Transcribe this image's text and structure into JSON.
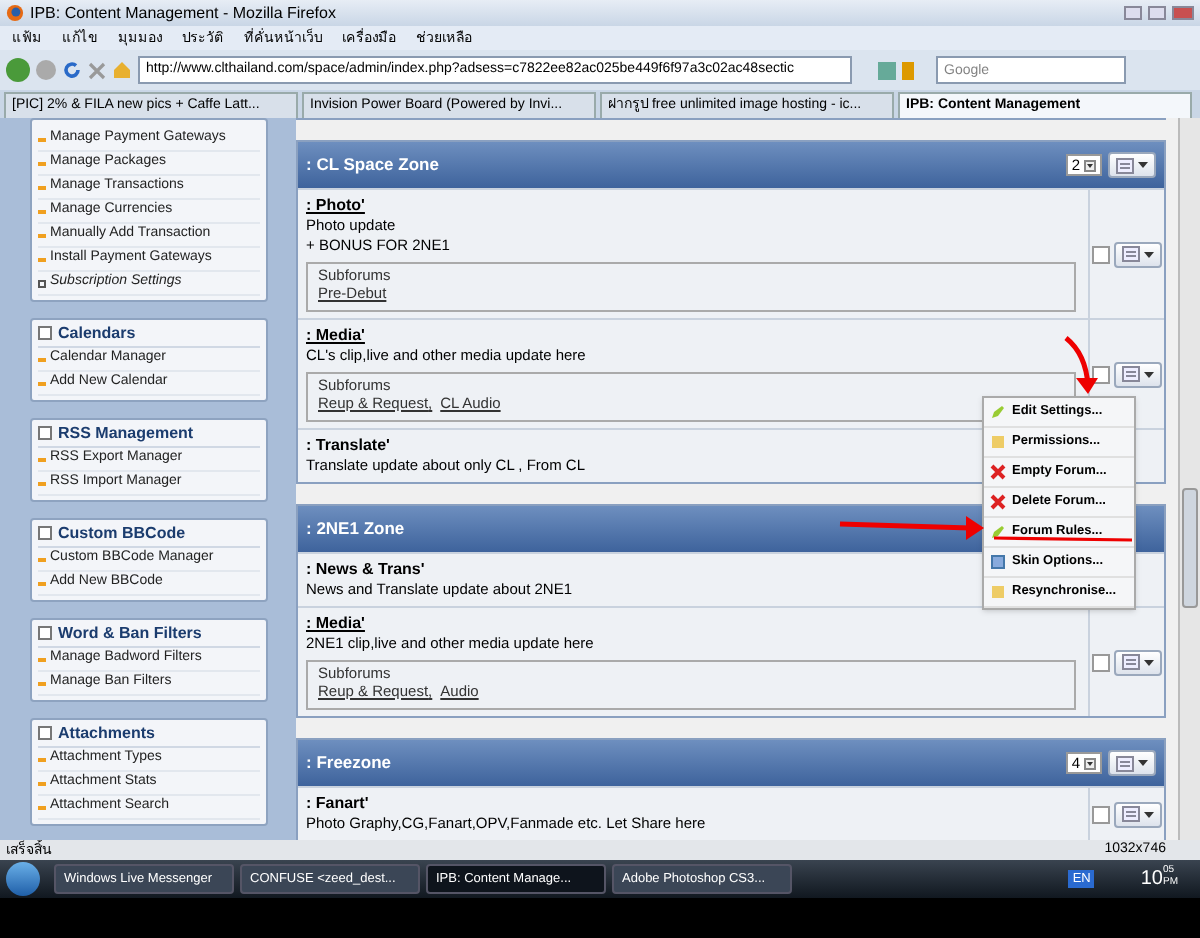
{
  "window": {
    "title": "IPB: Content Management - Mozilla Firefox"
  },
  "menu": [
    "แฟ้ม",
    "แก้ไข",
    "มุมมอง",
    "ประวัติ",
    "ที่คั่นหน้าเว็บ",
    "เครื่องมือ",
    "ช่วยเหลือ"
  ],
  "address": {
    "url": "http://www.clthailand.com/space/admin/index.php?adsess=c7822ee82ac025be449f6f97a3c02ac48sectic"
  },
  "search": {
    "placeholder": "Google"
  },
  "tabs": [
    {
      "label": "[PIC] 2% & FILA new pics + Caffe Latt...",
      "selected": false
    },
    {
      "label": "Invision Power Board (Powered by Invi...",
      "selected": false
    },
    {
      "label": "ฝากรูป free unlimited image hosting - ic...",
      "selected": false
    },
    {
      "label": "IPB: Content Management",
      "selected": true
    }
  ],
  "sidebar": [
    {
      "items": [
        {
          "label": "Manage Payment Gateways",
          "kind": "link"
        },
        {
          "label": "Manage Packages",
          "kind": "link"
        },
        {
          "label": "Manage Transactions",
          "kind": "link"
        },
        {
          "label": "Manage Currencies",
          "kind": "link"
        },
        {
          "label": "Manually Add Transaction",
          "kind": "link"
        },
        {
          "label": "Install Payment Gateways",
          "kind": "link"
        },
        {
          "label": "Subscription Settings",
          "kind": "setting"
        }
      ]
    },
    {
      "title": "Calendars",
      "items": [
        {
          "label": "Calendar Manager",
          "kind": "link"
        },
        {
          "label": "Add New Calendar",
          "kind": "link"
        }
      ]
    },
    {
      "title": "RSS Management",
      "items": [
        {
          "label": "RSS Export Manager",
          "kind": "link"
        },
        {
          "label": "RSS Import Manager",
          "kind": "link"
        }
      ]
    },
    {
      "title": "Custom BBCode",
      "items": [
        {
          "label": "Custom BBCode Manager",
          "kind": "link"
        },
        {
          "label": "Add New BBCode",
          "kind": "link"
        }
      ]
    },
    {
      "title": "Word & Ban Filters",
      "items": [
        {
          "label": "Manage Badword Filters",
          "kind": "link"
        },
        {
          "label": "Manage Ban Filters",
          "kind": "link"
        }
      ]
    },
    {
      "title": "Attachments",
      "items": [
        {
          "label": "Attachment Types",
          "kind": "link"
        },
        {
          "label": "Attachment Stats",
          "kind": "link"
        },
        {
          "label": "Attachment Search",
          "kind": "link"
        }
      ]
    }
  ],
  "categories": [
    {
      "title": ": CL Space Zone",
      "order": "2",
      "forums": [
        {
          "name": ": Photo'",
          "link": true,
          "description": [
            "Photo update",
            "+ BONUS FOR 2NE1"
          ],
          "subforums_label": "Subforums",
          "subforums": [
            "Pre-Debut"
          ],
          "controls": true,
          "checked": false
        },
        {
          "name": ": Media'",
          "link": true,
          "description": [
            "CL's clip,live and other media update here"
          ],
          "subforums_label": "Subforums",
          "subforums": [
            "Reup & Request",
            "CL Audio"
          ],
          "separator": ",",
          "controls": true,
          "checked": false
        },
        {
          "name": ": Translate'",
          "link": false,
          "description": [
            "Translate update about only CL , From CL"
          ],
          "controls": false
        }
      ]
    },
    {
      "title": ": 2NE1 Zone",
      "forums": [
        {
          "name": ": News & Trans'",
          "link": false,
          "description": [
            "News and Translate update about 2NE1"
          ],
          "controls": false
        },
        {
          "name": ": Media'",
          "link": true,
          "description": [
            "2NE1 clip,live and other media update here"
          ],
          "subforums_label": "Subforums",
          "subforums": [
            "Reup & Request",
            "Audio"
          ],
          "separator": ",",
          "controls": true,
          "checked": false
        }
      ]
    },
    {
      "title": ": Freezone",
      "order": "4",
      "forums": [
        {
          "name": ": Fanart'",
          "link": false,
          "description": [
            "Photo Graphy,CG,Fanart,OPV,Fanmade etc. Let Share here"
          ],
          "controls": true,
          "checked": false
        }
      ]
    }
  ],
  "popup_menu": [
    {
      "label": "Edit Settings...",
      "kind": "edit"
    },
    {
      "label": "Permissions...",
      "kind": "note"
    },
    {
      "label": "Empty Forum...",
      "kind": "delete"
    },
    {
      "label": "Delete Forum...",
      "kind": "delete"
    },
    {
      "label": "Forum Rules...",
      "kind": "edit"
    },
    {
      "label": "Skin Options...",
      "kind": "skin"
    },
    {
      "label": "Resynchronise...",
      "kind": "note"
    }
  ],
  "status_bar": {
    "text": "เสร็จสิ้น",
    "size": "1032x746"
  },
  "taskbar": {
    "items": [
      {
        "label": "Windows Live Messenger",
        "selected": false
      },
      {
        "label": "CONFUSE <zeed_dest...",
        "selected": false
      },
      {
        "label": "IPB: Content Manage...",
        "selected": true
      },
      {
        "label": "Adobe Photoshop CS3...",
        "selected": false
      }
    ],
    "language": "EN",
    "hour": "10",
    "minute": "05",
    "ampm": "PM"
  }
}
